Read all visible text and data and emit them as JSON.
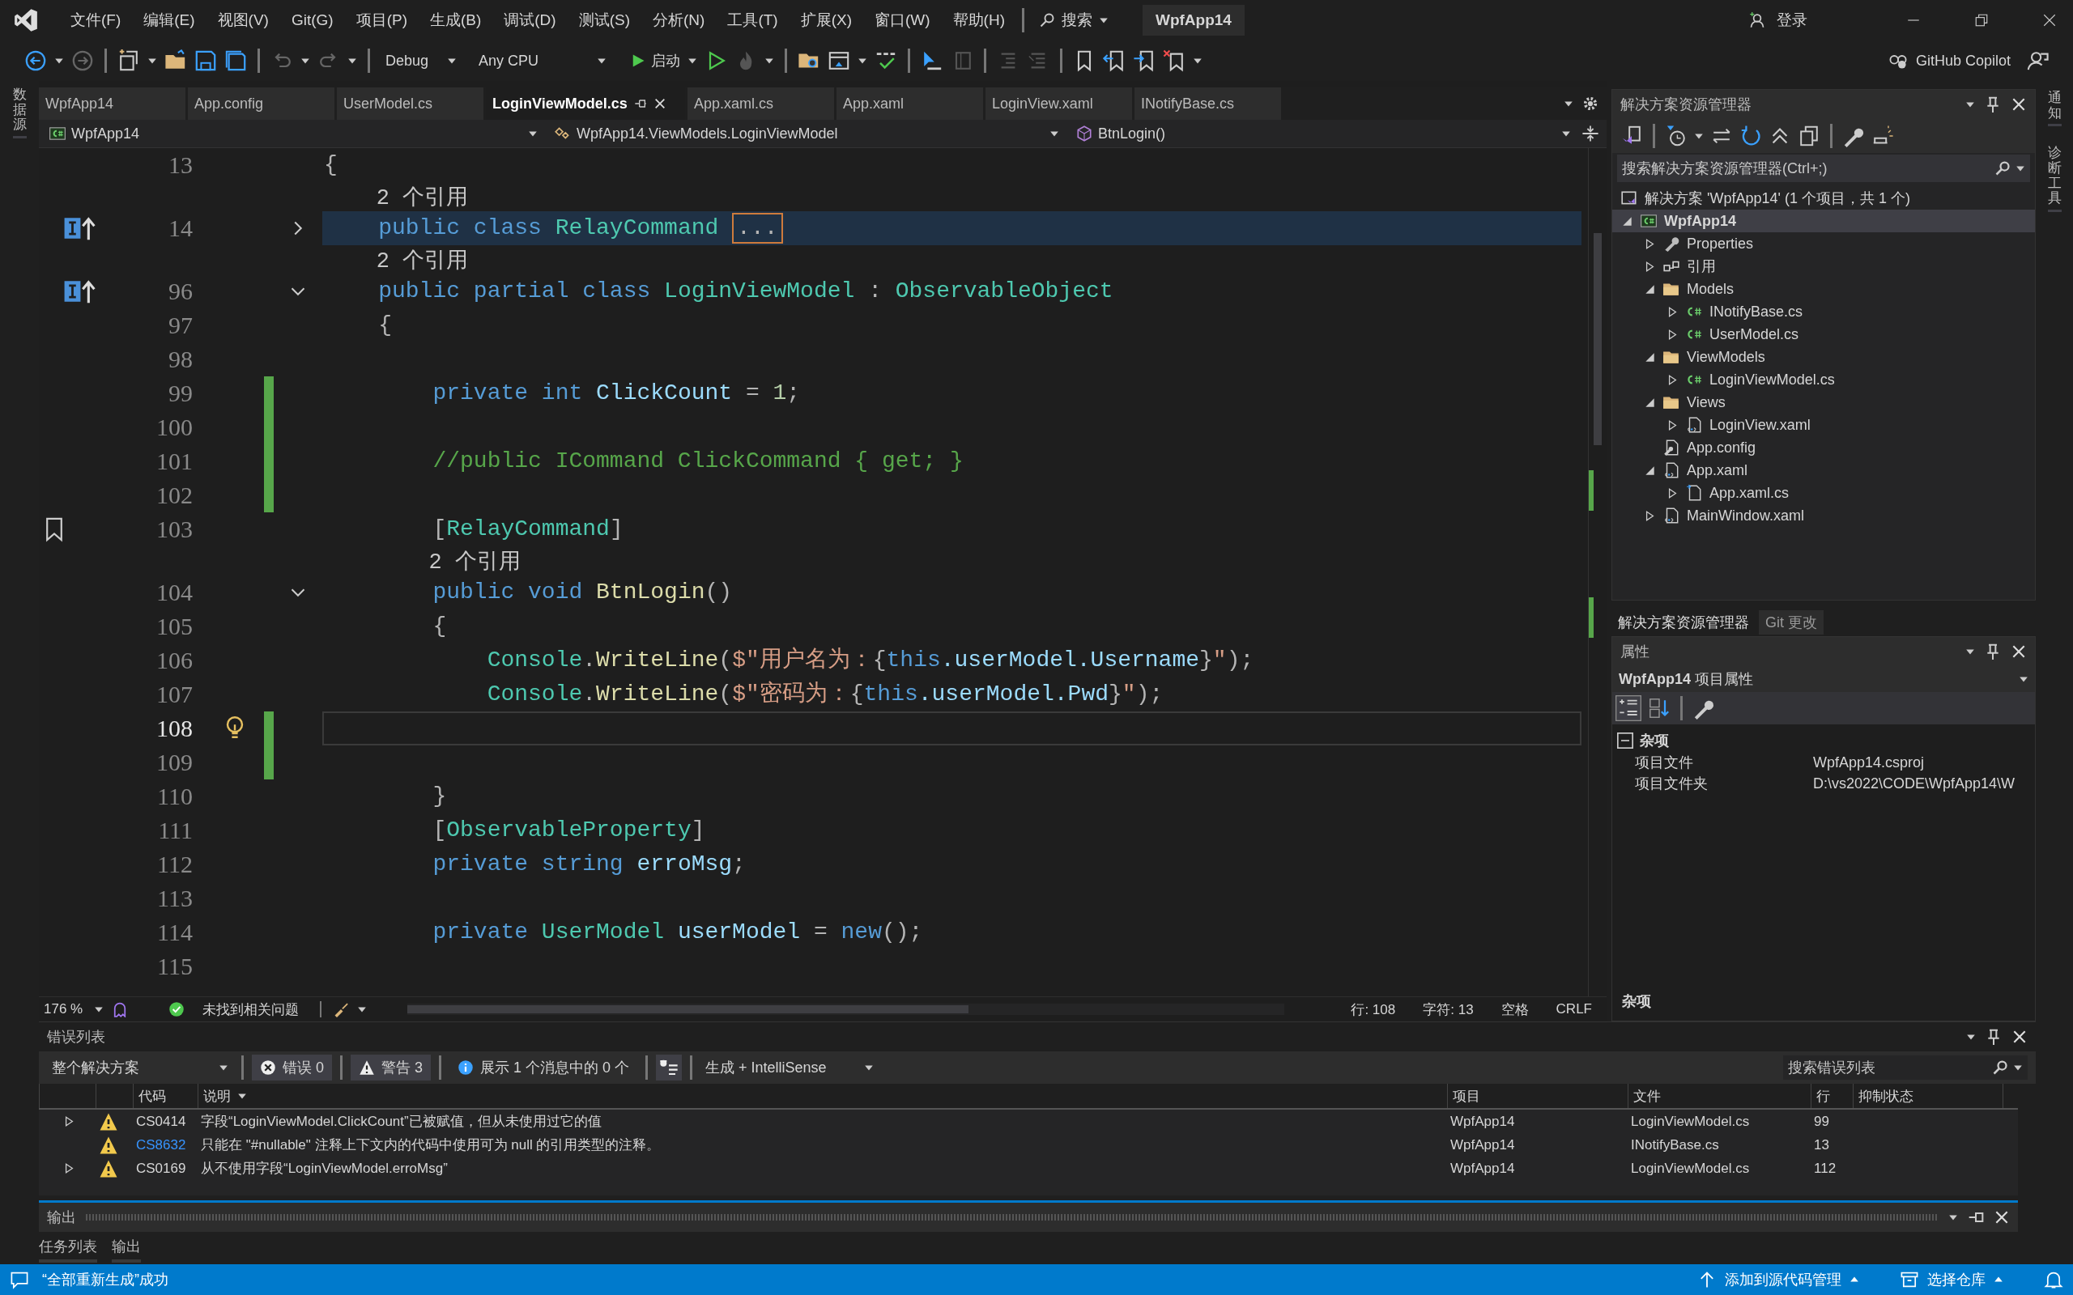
{
  "menu": {
    "items": [
      "文件(F)",
      "编辑(E)",
      "视图(V)",
      "Git(G)",
      "项目(P)",
      "生成(B)",
      "调试(D)",
      "测试(S)",
      "分析(N)",
      "工具(T)",
      "扩展(X)",
      "窗口(W)",
      "帮助(H)"
    ],
    "search": "搜索",
    "solution_name": "WpfApp14",
    "sign_in": "登录"
  },
  "toolbar": {
    "configuration": "Debug",
    "platform": "Any CPU",
    "start": "启动",
    "copilot": "GitHub Copilot"
  },
  "left_strip": {
    "label": "数据源"
  },
  "right_strip": {
    "labels": [
      "通知",
      "诊断工具"
    ]
  },
  "editor": {
    "tabs": [
      {
        "label": "WpfApp14",
        "selected": false
      },
      {
        "label": "App.config",
        "selected": false
      },
      {
        "label": "UserModel.cs",
        "selected": false
      },
      {
        "label": "LoginViewModel.cs",
        "selected": true
      },
      {
        "label": "App.xaml.cs",
        "selected": false
      },
      {
        "label": "App.xaml",
        "selected": false
      },
      {
        "label": "LoginView.xaml",
        "selected": false
      },
      {
        "label": "INotifyBase.cs",
        "selected": false
      }
    ],
    "nav": {
      "project": "WpfApp14",
      "type": "WpfApp14.ViewModels.LoginViewModel",
      "member": "BtnLogin()"
    },
    "lines": [
      {
        "kind": "code",
        "number": "13",
        "changed": false,
        "current": false,
        "highlighted": false,
        "tokens": [
          {
            "text": "{",
            "kind": "punct"
          }
        ]
      },
      {
        "kind": "lens",
        "text": "    2 个引用"
      },
      {
        "kind": "code",
        "number": "14",
        "changed": false,
        "current": false,
        "highlighted": true,
        "fold": {
          "expanded": false
        },
        "glyph": {
          "kind": "implementation"
        },
        "tokens": [
          {
            "text": "    public class ",
            "kind": "keyword"
          },
          {
            "text": "RelayCommand ",
            "kind": "type"
          },
          {
            "text": "...",
            "kind": "collapsed"
          }
        ]
      },
      {
        "kind": "lens",
        "text": "    2 个引用"
      },
      {
        "kind": "code",
        "number": "96",
        "changed": false,
        "current": false,
        "highlighted": false,
        "fold": {
          "expanded": true
        },
        "glyph": {
          "kind": "implementation"
        },
        "tokens": [
          {
            "text": "    public partial class ",
            "kind": "keyword"
          },
          {
            "text": "LoginViewModel ",
            "kind": "type"
          },
          {
            "text": ": ",
            "kind": "punct"
          },
          {
            "text": "ObservableObject",
            "kind": "type"
          }
        ]
      },
      {
        "kind": "code",
        "number": "97",
        "changed": false,
        "current": false,
        "highlighted": false,
        "tokens": [
          {
            "text": "    {",
            "kind": "punct"
          }
        ]
      },
      {
        "kind": "code",
        "number": "98",
        "changed": false,
        "current": false,
        "highlighted": false
      },
      {
        "kind": "code",
        "number": "99",
        "changed": true,
        "current": false,
        "highlighted": false,
        "tokens": [
          {
            "text": "        private int ",
            "kind": "keyword"
          },
          {
            "text": "ClickCount",
            "kind": "field"
          },
          {
            "text": " = ",
            "kind": "punct"
          },
          {
            "text": "1",
            "kind": "number"
          },
          {
            "text": ";",
            "kind": "punct"
          }
        ]
      },
      {
        "kind": "code",
        "number": "100",
        "changed": true,
        "current": false,
        "highlighted": false
      },
      {
        "kind": "code",
        "number": "101",
        "changed": true,
        "current": false,
        "highlighted": false,
        "tokens": [
          {
            "text": "        //public ICommand ClickCommand { get; }",
            "kind": "comment"
          }
        ]
      },
      {
        "kind": "code",
        "number": "102",
        "changed": true,
        "current": false,
        "highlighted": false
      },
      {
        "kind": "code",
        "number": "103",
        "changed": false,
        "current": false,
        "highlighted": false,
        "glyph": {
          "kind": "bookmark"
        },
        "tokens": [
          {
            "text": "        [",
            "kind": "punct"
          },
          {
            "text": "RelayCommand",
            "kind": "type"
          },
          {
            "text": "]",
            "kind": "punct"
          }
        ]
      },
      {
        "kind": "lens",
        "text": "        2 个引用"
      },
      {
        "kind": "code",
        "number": "104",
        "changed": false,
        "current": false,
        "highlighted": false,
        "fold": {
          "expanded": true
        },
        "tokens": [
          {
            "text": "        public void ",
            "kind": "keyword"
          },
          {
            "text": "BtnLogin",
            "kind": "method"
          },
          {
            "text": "()",
            "kind": "punct"
          }
        ]
      },
      {
        "kind": "code",
        "number": "105",
        "changed": false,
        "current": false,
        "highlighted": false,
        "tokens": [
          {
            "text": "        {",
            "kind": "punct"
          }
        ]
      },
      {
        "kind": "code",
        "number": "106",
        "changed": false,
        "current": false,
        "highlighted": false,
        "tokens": [
          {
            "text": "            Console",
            "kind": "type"
          },
          {
            "text": ".",
            "kind": "punct"
          },
          {
            "text": "WriteLine",
            "kind": "method"
          },
          {
            "text": "(",
            "kind": "punct"
          },
          {
            "text": "$\"用户名为：",
            "kind": "string"
          },
          {
            "text": "{",
            "kind": "punct"
          },
          {
            "text": "this",
            "kind": "keyword"
          },
          {
            "text": ".userModel.Username",
            "kind": "field"
          },
          {
            "text": "}",
            "kind": "punct"
          },
          {
            "text": "\"",
            "kind": "string"
          },
          {
            "text": ");",
            "kind": "punct"
          }
        ]
      },
      {
        "kind": "code",
        "number": "107",
        "changed": false,
        "current": false,
        "highlighted": false,
        "tokens": [
          {
            "text": "            Console",
            "kind": "type"
          },
          {
            "text": ".",
            "kind": "punct"
          },
          {
            "text": "WriteLine",
            "kind": "method"
          },
          {
            "text": "(",
            "kind": "punct"
          },
          {
            "text": "$\"密码为：",
            "kind": "string"
          },
          {
            "text": "{",
            "kind": "punct"
          },
          {
            "text": "this",
            "kind": "keyword"
          },
          {
            "text": ".userModel.Pwd",
            "kind": "field"
          },
          {
            "text": "}",
            "kind": "punct"
          },
          {
            "text": "\"",
            "kind": "string"
          },
          {
            "text": ");",
            "kind": "punct"
          }
        ]
      },
      {
        "kind": "code",
        "number": "108",
        "changed": true,
        "current": true,
        "highlighted": false,
        "glyph": {
          "kind": "lightbulb"
        }
      },
      {
        "kind": "code",
        "number": "109",
        "changed": true,
        "current": false,
        "highlighted": false
      },
      {
        "kind": "code",
        "number": "110",
        "changed": false,
        "current": false,
        "highlighted": false,
        "tokens": [
          {
            "text": "        }",
            "kind": "punct"
          }
        ]
      },
      {
        "kind": "code",
        "number": "111",
        "changed": false,
        "current": false,
        "highlighted": false,
        "tokens": [
          {
            "text": "        [",
            "kind": "punct"
          },
          {
            "text": "ObservableProperty",
            "kind": "type"
          },
          {
            "text": "]",
            "kind": "punct"
          }
        ]
      },
      {
        "kind": "code",
        "number": "112",
        "changed": false,
        "current": false,
        "highlighted": false,
        "tokens": [
          {
            "text": "        private string ",
            "kind": "keyword"
          },
          {
            "text": "erroMsg",
            "kind": "field"
          },
          {
            "text": ";",
            "kind": "punct"
          }
        ]
      },
      {
        "kind": "code",
        "number": "113",
        "changed": false,
        "current": false,
        "highlighted": false
      },
      {
        "kind": "code",
        "number": "114",
        "changed": false,
        "current": false,
        "highlighted": false,
        "tokens": [
          {
            "text": "        private ",
            "kind": "keyword"
          },
          {
            "text": "UserModel ",
            "kind": "type"
          },
          {
            "text": "userModel",
            "kind": "field"
          },
          {
            "text": " = ",
            "kind": "punct"
          },
          {
            "text": "new",
            "kind": "keyword"
          },
          {
            "text": "();",
            "kind": "punct"
          }
        ]
      },
      {
        "kind": "code",
        "number": "115",
        "changed": false,
        "current": false,
        "highlighted": false
      }
    ],
    "status": {
      "zoom": "176 %",
      "issues": "未找到相关问题",
      "line": "行: 108",
      "char": "字符: 13",
      "spacing": "空格",
      "line_ending": "CRLF"
    }
  },
  "solution_explorer": {
    "title": "解决方案资源管理器",
    "search_placeholder": "搜索解决方案资源管理器(Ctrl+;)",
    "tree": [
      {
        "label": "解决方案 'WpfApp14' (1 个项目，共 1 个)",
        "kind": "solution",
        "selected": false,
        "expandable": false,
        "children": [
          {
            "label": "WpfApp14",
            "kind": "project",
            "selected": true,
            "expandable": true,
            "expanded": true,
            "children": [
              {
                "label": "Properties",
                "kind": "properties",
                "selected": false,
                "expandable": true,
                "expanded": false
              },
              {
                "label": "引用",
                "kind": "references",
                "selected": false,
                "expandable": true,
                "expanded": false
              },
              {
                "label": "Models",
                "kind": "folder",
                "selected": false,
                "expandable": true,
                "expanded": true,
                "children": [
                  {
                    "label": "INotifyBase.cs",
                    "kind": "csharp",
                    "selected": false,
                    "expandable": true,
                    "expanded": false
                  },
                  {
                    "label": "UserModel.cs",
                    "kind": "csharp",
                    "selected": false,
                    "expandable": true,
                    "expanded": false
                  }
                ]
              },
              {
                "label": "ViewModels",
                "kind": "folder",
                "selected": false,
                "expandable": true,
                "expanded": true,
                "children": [
                  {
                    "label": "LoginViewModel.cs",
                    "kind": "csharp",
                    "selected": false,
                    "expandable": true,
                    "expanded": false
                  }
                ]
              },
              {
                "label": "Views",
                "kind": "folder",
                "selected": false,
                "expandable": true,
                "expanded": true,
                "children": [
                  {
                    "label": "LoginView.xaml",
                    "kind": "xaml",
                    "selected": false,
                    "expandable": true,
                    "expanded": false
                  }
                ]
              },
              {
                "label": "App.config",
                "kind": "config",
                "selected": false,
                "expandable": false
              },
              {
                "label": "App.xaml",
                "kind": "xaml",
                "selected": false,
                "expandable": true,
                "expanded": true,
                "children": [
                  {
                    "label": "App.xaml.cs",
                    "kind": "file",
                    "selected": false,
                    "expandable": true,
                    "expanded": false
                  }
                ]
              },
              {
                "label": "MainWindow.xaml",
                "kind": "xaml",
                "selected": false,
                "expandable": true,
                "expanded": false
              }
            ]
          }
        ]
      }
    ]
  },
  "panel_tabs": [
    {
      "label": "解决方案资源管理器",
      "selected": true
    },
    {
      "label": "Git 更改",
      "selected": false
    }
  ],
  "properties": {
    "title": "属性",
    "object": "**WpfApp14** 项目属性",
    "category": "杂项",
    "rows": [
      {
        "name": "项目文件",
        "value": "WpfApp14.csproj"
      },
      {
        "name": "项目文件夹",
        "value": "D:\\vs2022\\CODE\\WpfApp14\\W"
      }
    ],
    "description_title": "杂项"
  },
  "error_list": {
    "title": "错误列表",
    "scope": "整个解决方案",
    "filters": [
      {
        "kind": "error",
        "label": "错误 0",
        "selected": true
      },
      {
        "kind": "warning",
        "label": "警告 3",
        "selected": true
      },
      {
        "kind": "info",
        "label": "展示 1 个消息中的 0 个",
        "selected": false
      }
    ],
    "source": "生成 + IntelliSense",
    "search_placeholder": "搜索错误列表",
    "columns": [
      "代码",
      "说明",
      "项目",
      "文件",
      "行",
      "抑制状态"
    ],
    "rows": [
      {
        "expandable": true,
        "code": "CS0414",
        "link": false,
        "description": "字段“LoginViewModel.ClickCount”已被赋值，但从未使用过它的值",
        "project": "WpfApp14",
        "file": "LoginViewModel.cs",
        "line": "99"
      },
      {
        "expandable": false,
        "code": "CS8632",
        "link": true,
        "description": "只能在 \"#nullable\" 注释上下文内的代码中使用可为 null 的引用类型的注释。",
        "project": "WpfApp14",
        "file": "INotifyBase.cs",
        "line": "13"
      },
      {
        "expandable": true,
        "code": "CS0169",
        "link": false,
        "description": "从不使用字段“LoginViewModel.erroMsg”",
        "project": "WpfApp14",
        "file": "LoginViewModel.cs",
        "line": "112"
      }
    ]
  },
  "output": {
    "title": "输出"
  },
  "bottom_tabs": [
    {
      "label": "任务列表",
      "selected": false
    },
    {
      "label": "输出",
      "selected": false
    }
  ],
  "status_bar": {
    "message": "“全部重新生成”成功",
    "source_control": "添加到源代码管理",
    "repository": "选择仓库"
  }
}
